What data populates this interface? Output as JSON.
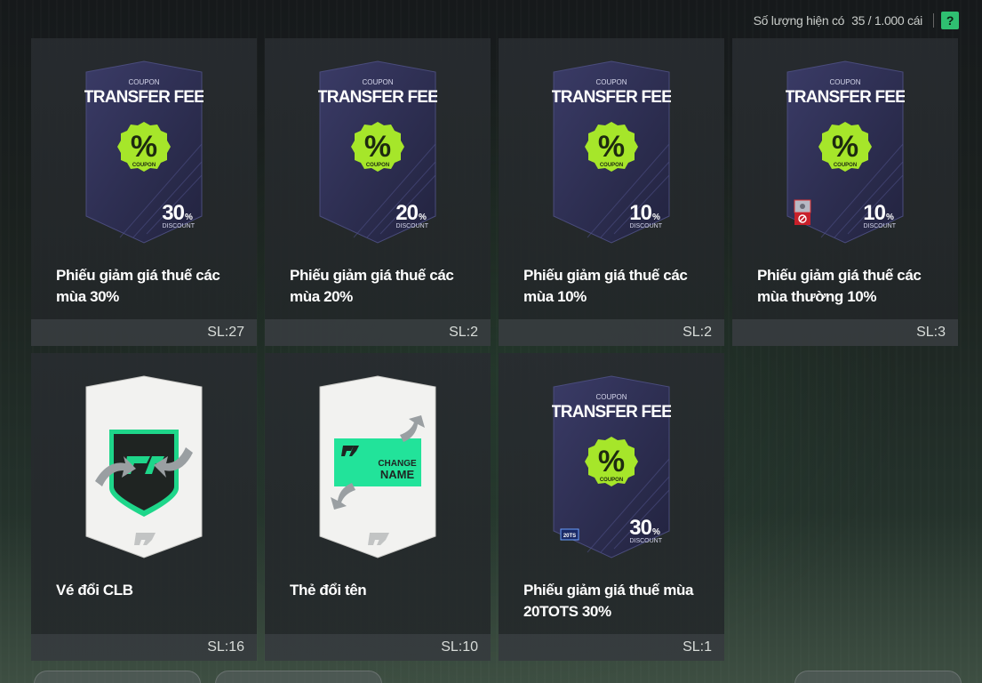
{
  "header": {
    "quantity_label": "Số lượng hiện có",
    "quantity_value": "35 / 1.000 cái",
    "help_label": "?"
  },
  "items": [
    {
      "card": "coupon",
      "coupon_small": "COUPON",
      "coupon_title": "TRANSFER FEE",
      "badge": "%",
      "badge_sub": "COUPON",
      "pct": "30",
      "pct_unit": "%",
      "discount": "DISCOUNT",
      "name": "Phiếu giảm giá thuế các mùa 30%",
      "qty": "SL:27"
    },
    {
      "card": "coupon",
      "coupon_small": "COUPON",
      "coupon_title": "TRANSFER FEE",
      "badge": "%",
      "badge_sub": "COUPON",
      "pct": "20",
      "pct_unit": "%",
      "discount": "DISCOUNT",
      "name": "Phiếu giảm giá thuế các mùa 20%",
      "qty": "SL:2"
    },
    {
      "card": "coupon",
      "coupon_small": "COUPON",
      "coupon_title": "TRANSFER FEE",
      "badge": "%",
      "badge_sub": "COUPON",
      "pct": "10",
      "pct_unit": "%",
      "discount": "DISCOUNT",
      "name": "Phiếu giảm giá thuế các mùa 10%",
      "qty": "SL:2"
    },
    {
      "card": "coupon",
      "coupon_small": "COUPON",
      "coupon_title": "TRANSFER FEE",
      "badge": "%",
      "badge_sub": "COUPON",
      "pct": "10",
      "pct_unit": "%",
      "discount": "DISCOUNT",
      "name": "Phiếu giảm giá thuế các mùa thường 10%",
      "qty": "SL:3"
    },
    {
      "card": "club",
      "name": "Vé đổi CLB",
      "qty": "SL:16"
    },
    {
      "card": "rename",
      "rename_line1": "CHANGE",
      "rename_line2": "NAME",
      "name": "Thẻ đổi tên",
      "qty": "SL:10"
    },
    {
      "card": "coupon",
      "coupon_small": "COUPON",
      "coupon_title": "TRANSFER FEE",
      "badge": "%",
      "badge_sub": "COUPON",
      "pct": "30",
      "pct_unit": "%",
      "discount": "DISCOUNT",
      "season_tag": "20TS",
      "name": "Phiếu giảm giá thuế mùa 20TOTS 30%",
      "qty": "SL:1"
    }
  ],
  "colors": {
    "accent_green": "#2fbf71",
    "coupon_badge": "#a6e62a",
    "card_purple": "#2f3056"
  }
}
